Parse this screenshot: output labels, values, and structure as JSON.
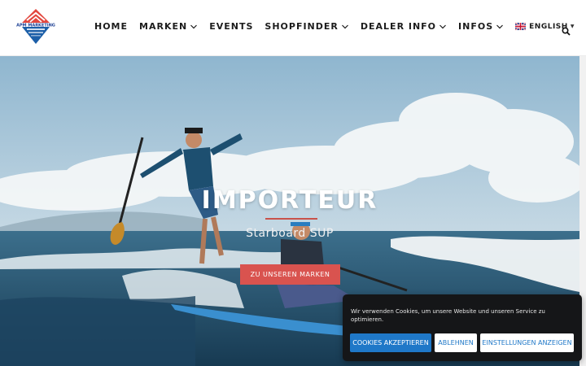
{
  "header": {
    "logo_text": "APM MARKETING",
    "nav": [
      {
        "label": "HOME",
        "has_dropdown": false
      },
      {
        "label": "MARKEN",
        "has_dropdown": true
      },
      {
        "label": "EVENTS",
        "has_dropdown": false
      },
      {
        "label": "SHOPFINDER",
        "has_dropdown": true
      },
      {
        "label": "DEALER INFO",
        "has_dropdown": true
      },
      {
        "label": "INFOS",
        "has_dropdown": true
      }
    ],
    "language": {
      "label": "ENGLISH",
      "flag": "uk-flag-icon"
    },
    "search_icon": "search-icon"
  },
  "hero": {
    "title": "IMPORTEUR",
    "subtitle": "Starboard SUP",
    "button_label": "ZU UNSEREN MARKEN"
  },
  "cookie": {
    "text": "Wir verwenden Cookies, um unsere Website und unseren Service zu optimieren.",
    "accept_label": "COOKIES AKZEPTIEREN",
    "reject_label": "ABLEHNEN",
    "settings_label": "EINSTELLUNGEN ANZEIGEN"
  },
  "colors": {
    "accent_red": "#d9534f",
    "cookie_bg": "#151618",
    "cookie_blue": "#1f78c8",
    "nav_text": "#1c1c1c"
  }
}
